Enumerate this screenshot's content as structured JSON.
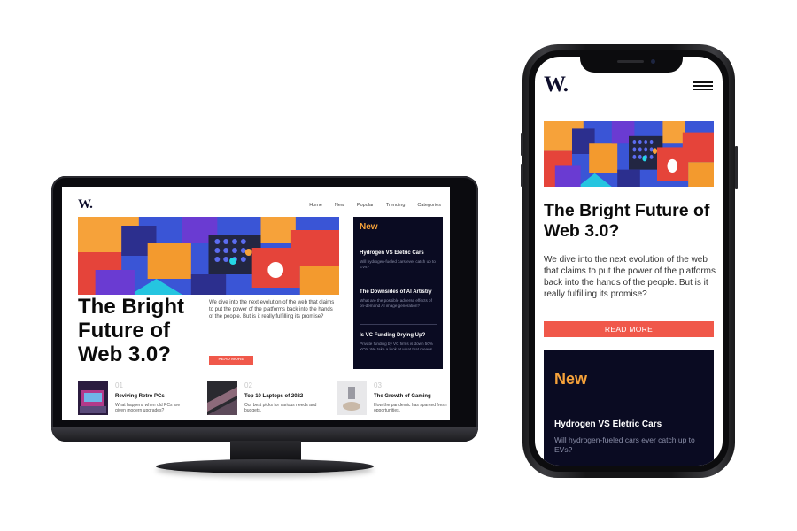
{
  "site": {
    "logo": "W.",
    "nav": [
      "Home",
      "New",
      "Popular",
      "Trending",
      "Categories"
    ]
  },
  "hero": {
    "title": "The Bright Future of Web 3.0?",
    "description": "We dive into the next evolution of the web that claims to put the power of the platforms back into the hands of the people. But is it really fulfilling its promise?",
    "button": "READ MORE"
  },
  "sidebar": {
    "heading": "New",
    "items": [
      {
        "title": "Hydrogen VS Eletric Cars",
        "desc": "Will hydrogen-fueled cars ever catch up to EVs?"
      },
      {
        "title": "The Downsides of AI Artistry",
        "desc": "What are the possible adverse effects of on-demand AI image generation?"
      },
      {
        "title": "Is VC Funding Drying Up?",
        "desc": "Private funding by VC firms is down 50% YOY. We take a look at what that means."
      }
    ]
  },
  "cards": [
    {
      "num": "01",
      "title": "Reviving Retro PCs",
      "desc": "What happens when old PCs are given modern upgrades?"
    },
    {
      "num": "02",
      "title": "Top 10 Laptops of 2022",
      "desc": "Our best picks for various needs and budgets."
    },
    {
      "num": "03",
      "title": "The Growth of Gaming",
      "desc": "How the pandemic has sparked fresh opportunities."
    }
  ],
  "colors": {
    "accent": "#f0584a",
    "sidebar_bg": "#0a0b22",
    "sidebar_heading": "#f6a23a",
    "logo": "#0d0d2b"
  }
}
